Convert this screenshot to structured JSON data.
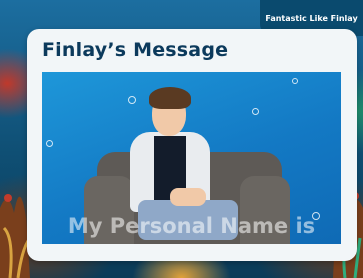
{
  "banner": {
    "label": "Fantastic Like Finlay"
  },
  "card": {
    "title": "Finlay’s Message"
  },
  "video": {
    "caption": "My Personal Name is"
  }
}
